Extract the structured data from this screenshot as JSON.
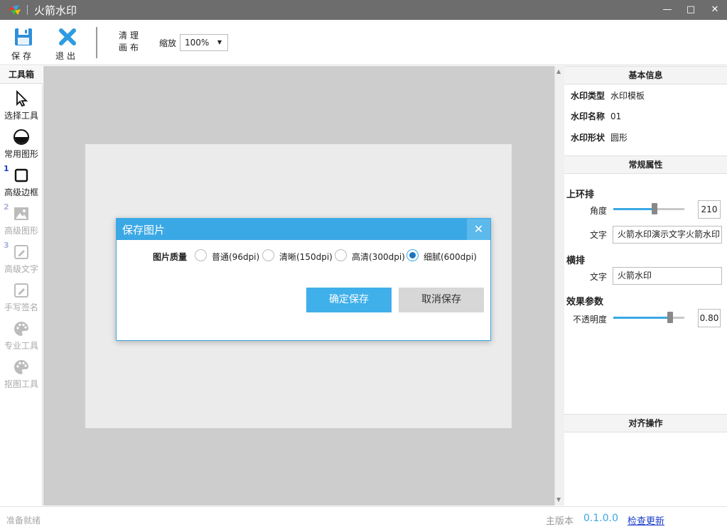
{
  "window": {
    "title": "火箭水印",
    "minimize_icon": "minimize-icon",
    "maximize_icon": "maximize-icon",
    "close_icon": "close-icon"
  },
  "toolbar": {
    "save_label": "保存",
    "exit_label": "退出",
    "clear_label_line1": "清理",
    "clear_label_line2": "画布",
    "zoom_label": "缩放",
    "zoom_value": "100%"
  },
  "toolbox": {
    "title": "工具箱",
    "tools": [
      {
        "label": "选择工具",
        "icon": "cursor-arrow-icon",
        "enabled": true
      },
      {
        "label": "常用图形",
        "icon": "shape-circle-icon",
        "enabled": true
      },
      {
        "label": "高级边框",
        "icon": "square-border-icon",
        "enabled": true,
        "number": "1"
      },
      {
        "label": "高级图形",
        "icon": "image-icon",
        "enabled": false,
        "number": "2"
      },
      {
        "label": "高级文字",
        "icon": "edit-text-icon",
        "enabled": false,
        "number": "3"
      },
      {
        "label": "手写签名",
        "icon": "signature-pen-icon",
        "enabled": false
      },
      {
        "label": "专业工具",
        "icon": "palette-icon",
        "enabled": false
      },
      {
        "label": "抠图工具",
        "icon": "palette-icon",
        "enabled": false
      }
    ]
  },
  "panel": {
    "basic_info_title": "基本信息",
    "type_label": "水印类型",
    "type_value": "水印模板",
    "name_label": "水印名称",
    "name_value": "01",
    "shape_label": "水印形状",
    "shape_value": "圆形",
    "general_title": "常规属性",
    "ring_title": "上环排",
    "angle_label": "角度",
    "angle_value": "210",
    "angle_fraction": 0.58,
    "ring_text_label": "文字",
    "ring_text_value": "火箭水印演示文字火箭水印",
    "horizontal_title": "横排",
    "horizontal_text_label": "文字",
    "horizontal_text_value": "火箭水印",
    "effect_title": "效果参数",
    "opacity_label": "不透明度",
    "opacity_value": "0.80",
    "opacity_fraction": 0.8,
    "align_title": "对齐操作"
  },
  "dialog": {
    "title": "保存图片",
    "quality_label": "图片质量",
    "options": [
      {
        "label": "普通(96dpi)",
        "checked": false
      },
      {
        "label": "清晰(150dpi)",
        "checked": false
      },
      {
        "label": "高清(300dpi)",
        "checked": false
      },
      {
        "label": "细腻(600dpi)",
        "checked": true
      }
    ],
    "confirm_label": "确定保存",
    "cancel_label": "取消保存"
  },
  "status": {
    "text": "准备就绪",
    "version_label": "主版本",
    "version_value": "0.1.0.0",
    "update_link": "检查更新"
  },
  "colors": {
    "accent": "#3aa8e4",
    "titlebar": "#6d6d6d",
    "canvas_bg": "#cdcdcd",
    "artboard": "#ebebeb"
  }
}
